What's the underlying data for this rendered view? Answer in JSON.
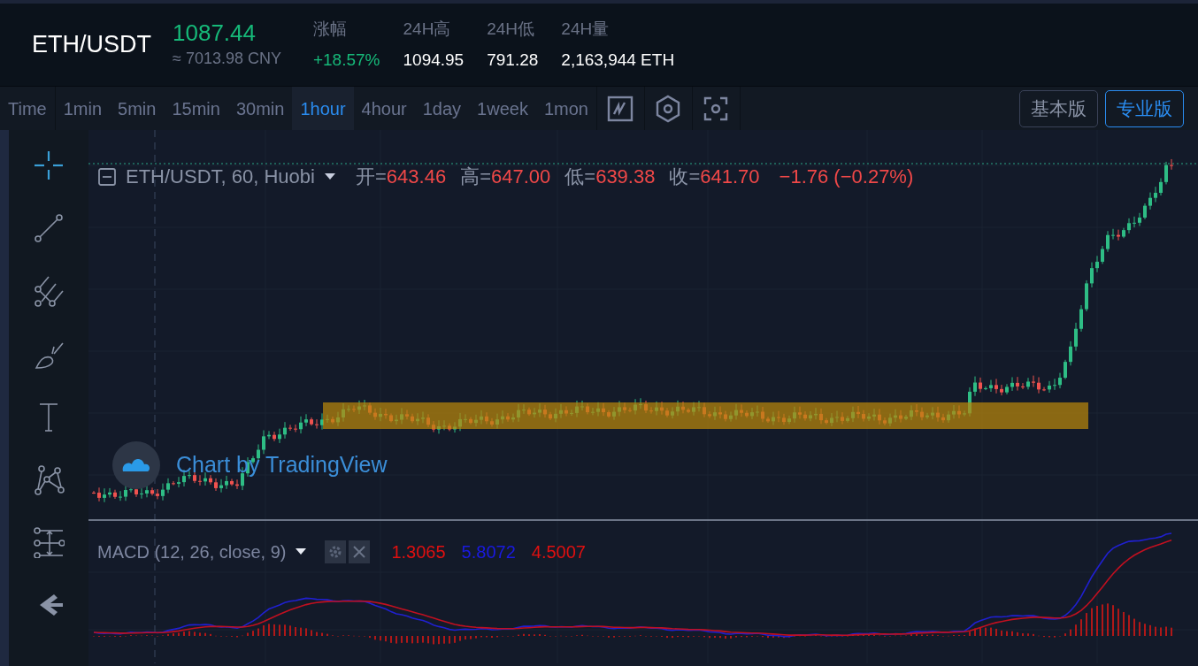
{
  "header": {
    "pair": "ETH/USDT",
    "price": "1087.44",
    "cny": "≈ 7013.98 CNY",
    "stats": [
      {
        "label": "涨幅",
        "value": "+18.57%",
        "kind": "up"
      },
      {
        "label": "24H高",
        "value": "1094.95",
        "kind": "plain"
      },
      {
        "label": "24H低",
        "value": "791.28",
        "kind": "plain"
      },
      {
        "label": "24H量",
        "value": "2,163,944 ETH",
        "kind": "plain"
      }
    ]
  },
  "intervals": [
    {
      "label": "Time",
      "selected": false
    },
    {
      "label": "1min",
      "selected": false
    },
    {
      "label": "5min",
      "selected": false
    },
    {
      "label": "15min",
      "selected": false
    },
    {
      "label": "30min",
      "selected": false
    },
    {
      "label": "1hour",
      "selected": true
    },
    {
      "label": "4hour",
      "selected": false
    },
    {
      "label": "1day",
      "selected": false
    },
    {
      "label": "1week",
      "selected": false
    },
    {
      "label": "1mon",
      "selected": false
    }
  ],
  "toolbar_icons": [
    {
      "kind": "indicator"
    },
    {
      "kind": "settings"
    },
    {
      "kind": "screenshot"
    }
  ],
  "versions": [
    {
      "label": "基本版",
      "selected": false
    },
    {
      "label": "专业版",
      "selected": true
    }
  ],
  "tools": [
    {
      "kind": "crosshair",
      "selected": true
    },
    {
      "kind": "trend-line",
      "selected": false
    },
    {
      "kind": "pitchfork",
      "selected": false
    },
    {
      "kind": "brush",
      "selected": false
    },
    {
      "kind": "text",
      "selected": false
    },
    {
      "kind": "pattern",
      "selected": false
    },
    {
      "kind": "measure",
      "selected": false
    },
    {
      "kind": "back",
      "selected": false
    }
  ],
  "legend": {
    "symbol": "ETH/USDT, 60, Huobi",
    "fields": [
      {
        "label": "开=",
        "value": "643.46"
      },
      {
        "label": "高=",
        "value": "647.00"
      },
      {
        "label": "低=",
        "value": "639.38"
      },
      {
        "label": "收=",
        "value": "641.70"
      }
    ],
    "change": "−1.76 (−0.27%)"
  },
  "branding": "Chart by TradingView",
  "macd": {
    "label": "MACD (12, 26, close, 9)",
    "values": [
      {
        "value": "1.3065",
        "color": "#e01010"
      },
      {
        "value": "5.8072",
        "color": "#1a1ae0"
      },
      {
        "value": "4.5007",
        "color": "#e01010"
      }
    ]
  }
}
